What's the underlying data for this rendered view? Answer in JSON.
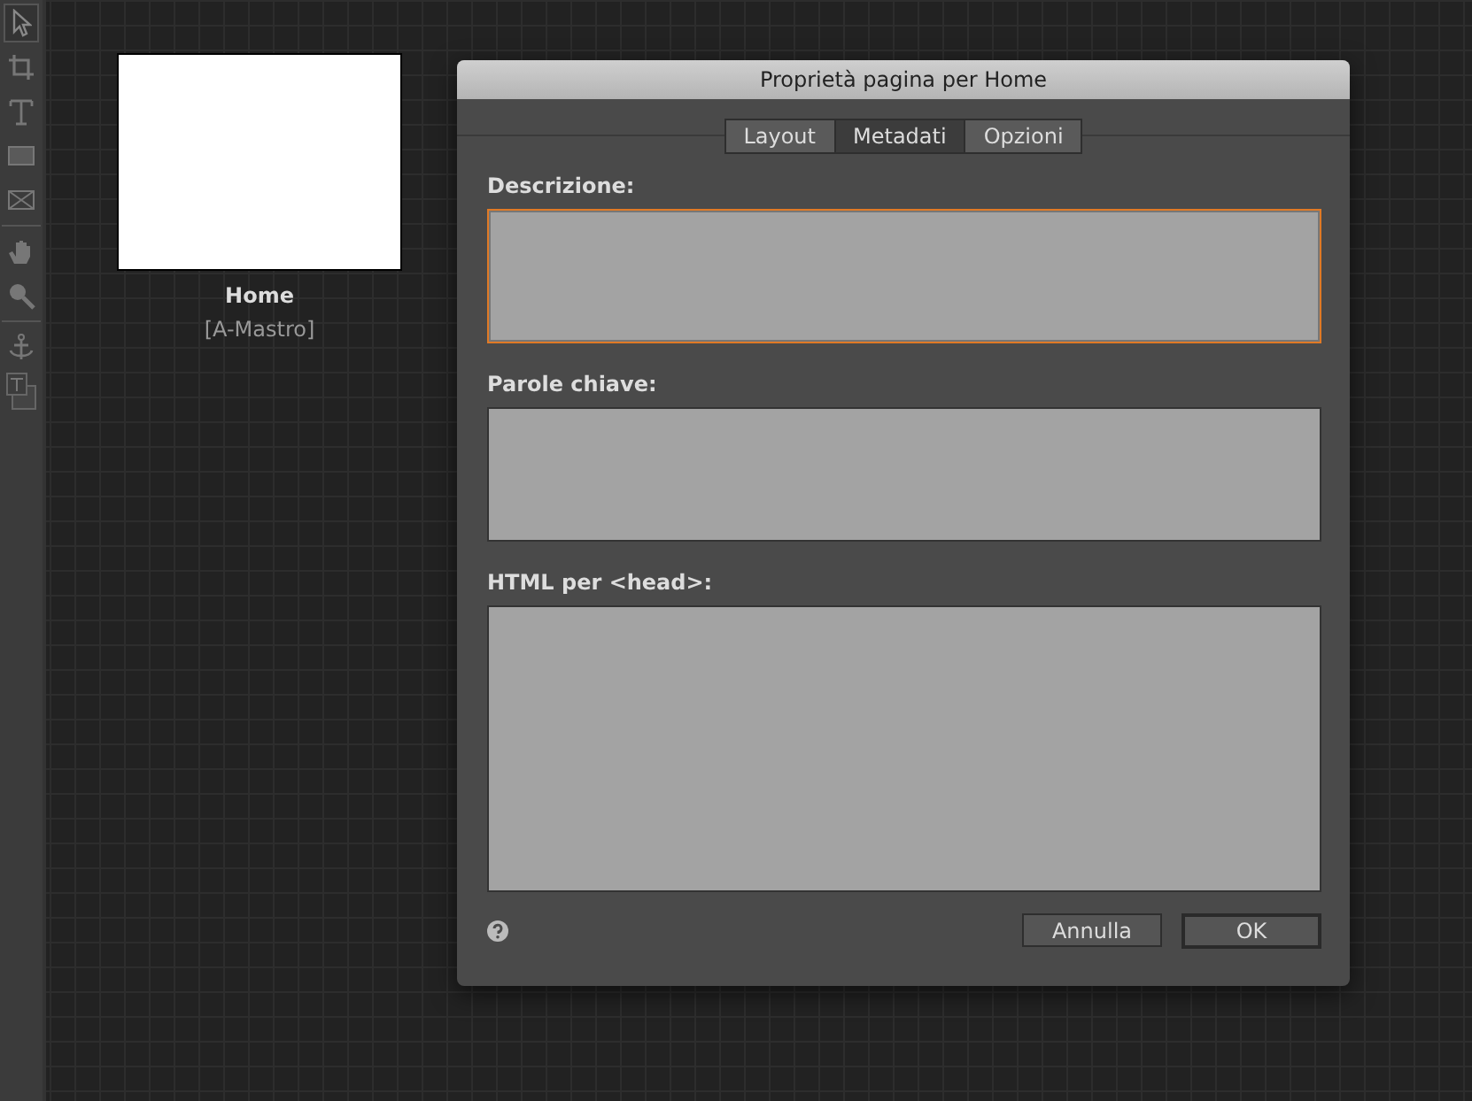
{
  "toolbar": {
    "tools": [
      {
        "kind": "select",
        "selected": true
      },
      {
        "kind": "crop",
        "selected": false
      },
      {
        "kind": "text",
        "selected": false
      },
      {
        "kind": "rectangle",
        "selected": false
      },
      {
        "kind": "frame",
        "selected": false
      },
      {
        "kind": "hand",
        "selected": false
      },
      {
        "kind": "zoom",
        "selected": false
      },
      {
        "kind": "anchor",
        "selected": false
      },
      {
        "kind": "textframe",
        "selected": false
      }
    ]
  },
  "page": {
    "name": "Home",
    "master": "[A-Mastro]"
  },
  "dialog": {
    "title": "Proprietà pagina per Home",
    "tabs": [
      {
        "label": "Layout",
        "selected": false
      },
      {
        "label": "Metadati",
        "selected": true
      },
      {
        "label": "Opzioni",
        "selected": false
      }
    ],
    "fields": [
      {
        "label": "Descrizione:",
        "focused": true,
        "kind": "short"
      },
      {
        "label": "Parole chiave:",
        "focused": false,
        "kind": "short"
      },
      {
        "label": "HTML per <head>:",
        "focused": false,
        "kind": "tall"
      }
    ],
    "buttons": [
      {
        "label": "Annulla",
        "default": false
      },
      {
        "label": "OK",
        "default": true
      }
    ]
  }
}
